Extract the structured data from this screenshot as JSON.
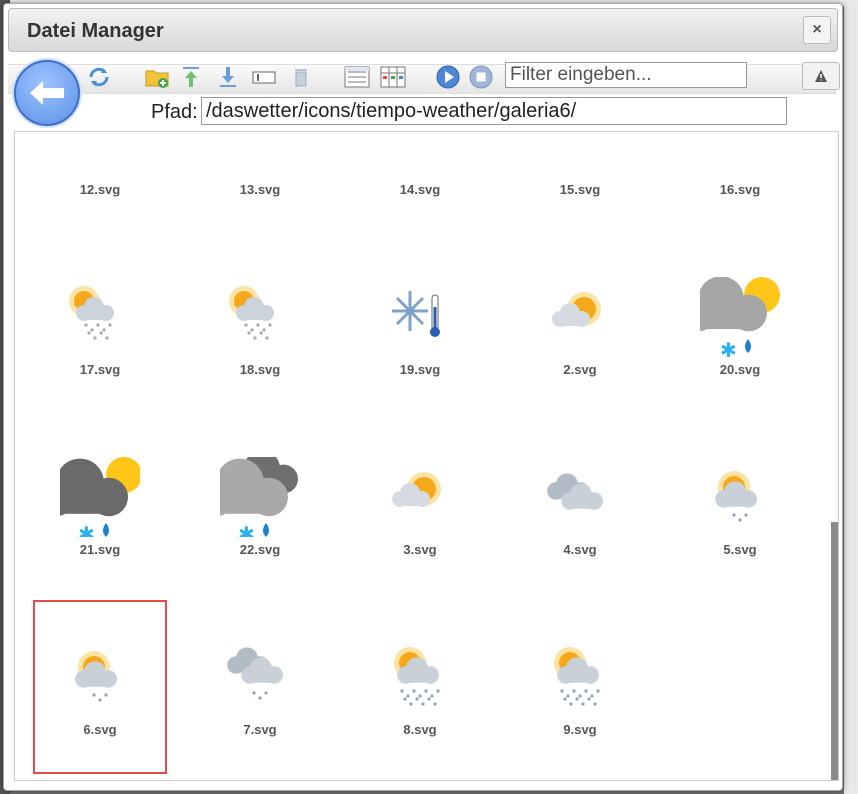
{
  "window": {
    "title": "Datei Manager",
    "close_label": "×"
  },
  "toolbar": {
    "filter_placeholder": "Filter eingeben...",
    "icons": [
      "back-icon",
      "refresh-icon",
      "new-folder-icon",
      "upload-icon",
      "download-icon",
      "rename-icon",
      "delete-icon",
      "list-view-icon",
      "table-view-icon",
      "play-icon",
      "stop-icon",
      "warning-icon"
    ]
  },
  "path": {
    "label": "Pfad:",
    "value": "/daswetter/icons/tiempo-weather/galeria6/"
  },
  "files": [
    {
      "name": "12.svg",
      "icon": "thunderstorm-icon"
    },
    {
      "name": "13.svg",
      "icon": "thunderstorm-icon"
    },
    {
      "name": "14.svg",
      "icon": "hail-cloud-icon"
    },
    {
      "name": "15.svg",
      "icon": "hail-cloud-icon"
    },
    {
      "name": "16.svg",
      "icon": "hail-cloud-icon"
    },
    {
      "name": "17.svg",
      "icon": "sun-cloud-snow-icon"
    },
    {
      "name": "18.svg",
      "icon": "sun-cloud-snow-icon"
    },
    {
      "name": "19.svg",
      "icon": "snowflake-thermometer-icon"
    },
    {
      "name": "2.svg",
      "icon": "sun-cloud-icon"
    },
    {
      "name": "20.svg",
      "icon": "flat-sun-cloud-sleet-icon"
    },
    {
      "name": "21.svg",
      "icon": "flat-sun-darkcloud-sleet-icon"
    },
    {
      "name": "22.svg",
      "icon": "flat-clouds-sleet-icon"
    },
    {
      "name": "3.svg",
      "icon": "sun-cloud-icon"
    },
    {
      "name": "4.svg",
      "icon": "clouds-icon"
    },
    {
      "name": "5.svg",
      "icon": "sun-cloud-drizzle-icon"
    },
    {
      "name": "6.svg",
      "icon": "sun-cloud-drizzle-icon",
      "selected": true
    },
    {
      "name": "7.svg",
      "icon": "clouds-drizzle-icon"
    },
    {
      "name": "8.svg",
      "icon": "sun-cloud-rain-icon"
    },
    {
      "name": "9.svg",
      "icon": "sun-cloud-rain-icon"
    }
  ],
  "colors": {
    "selection": "#e14d4d",
    "back_button": "#5b8fe6",
    "sun": "#f6b21b",
    "cloud": "#a9a9a9"
  }
}
